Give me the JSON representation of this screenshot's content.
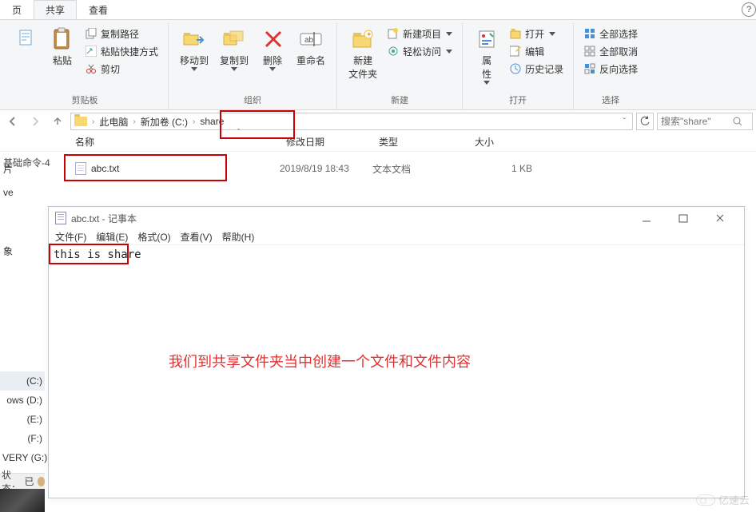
{
  "tabs": {
    "share": "共享",
    "view": "查看"
  },
  "ribbon": {
    "paste": "粘贴",
    "copy_path": "复制路径",
    "paste_shortcut": "粘贴快捷方式",
    "cut": "剪切",
    "group_clipboard": "剪贴板",
    "move_to": "移动到",
    "copy_to": "复制到",
    "delete": "删除",
    "rename": "重命名",
    "group_organize": "组织",
    "new_folder": "新建\n文件夹",
    "new_item": "新建项目",
    "easy_access": "轻松访问",
    "group_new": "新建",
    "properties": "属\n性",
    "open": "打开",
    "edit": "编辑",
    "history": "历史记录",
    "group_open": "打开",
    "select_all": "全部选择",
    "select_none": "全部取消",
    "invert_selection": "反向选择",
    "group_select": "选择"
  },
  "breadcrumb": {
    "this_pc": "此电脑",
    "volume": "新加卷 (C:)",
    "folder": "share"
  },
  "search": {
    "prefix": "搜索",
    "placeholder": "搜索\"share\""
  },
  "left_label": "基础命令-4",
  "columns": {
    "name": "名称",
    "date": "修改日期",
    "type": "类型",
    "size": "大小"
  },
  "nav": {
    "pictures": "片",
    "drive_label": "ve"
  },
  "files": [
    {
      "name": "abc.txt",
      "date": "2019/8/19 18:43",
      "type": "文本文档",
      "size": "1 KB"
    }
  ],
  "notepad": {
    "title": "abc.txt - 记事本",
    "menu": {
      "file": "文件(F)",
      "edit": "编辑(E)",
      "format": "格式(O)",
      "view": "查看(V)",
      "help": "帮助(H)"
    },
    "content": "this is share"
  },
  "annotation": "我们到共享文件夹当中创建一个文件和文件内容",
  "drives": {
    "c": "(C:)",
    "d": "ows (D:)",
    "e": "(E:)",
    "f": "(F:)",
    "g": "VERY (G:)"
  },
  "status": {
    "label": "状态：",
    "ready": "已"
  },
  "sidebar_item": "象",
  "watermark": "亿速云"
}
